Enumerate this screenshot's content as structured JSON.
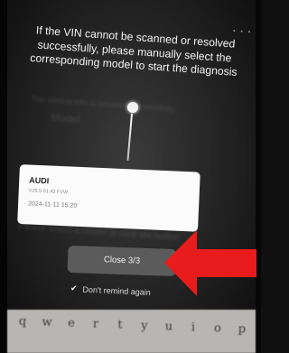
{
  "status_indicator": "• • •",
  "guide": {
    "message": "If the VIN cannot be scanned or resolved successfully, please manually select the corresponding model to start the diagnosis"
  },
  "background": {
    "line1": "The vehicle info is resolved successfully",
    "line2": "Model",
    "line3": "Please select a model or click the button"
  },
  "vehicle_card": {
    "brand": "AUDI",
    "model": "V25.5.01.43 FVW",
    "date": "2024-11-11 15:20"
  },
  "close_button": {
    "label": "Close 3/3"
  },
  "dont_remind": {
    "label": "Don't remind again",
    "icon": "check-icon"
  },
  "keyboard": {
    "keys": [
      "q",
      "w",
      "e",
      "r",
      "t",
      "y",
      "u",
      "i",
      "o",
      "p"
    ]
  },
  "colors": {
    "arrow": "#e81c1c",
    "card": "#fbfbfb",
    "overlay": "#262626"
  }
}
